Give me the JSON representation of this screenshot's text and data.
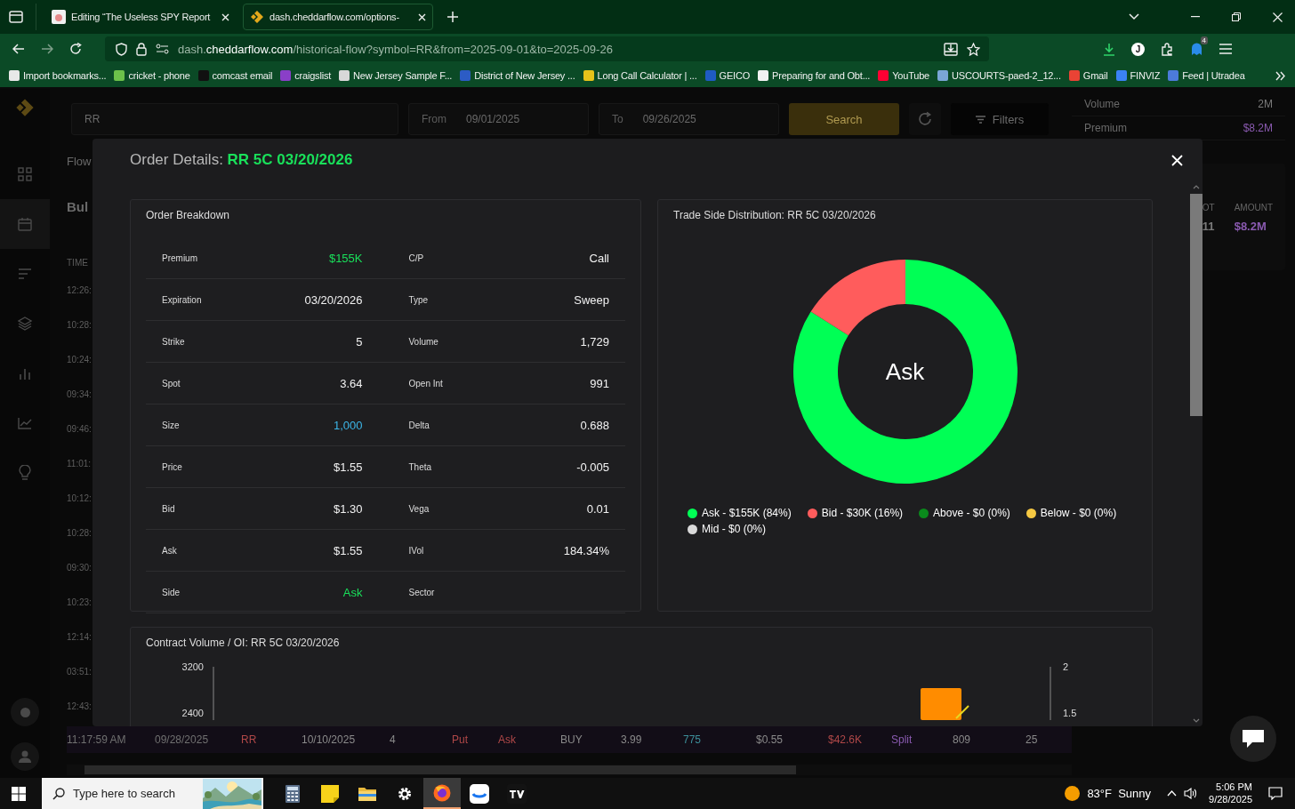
{
  "browser": {
    "tabs": [
      {
        "title": "Editing “The Useless SPY Report",
        "selected": false
      },
      {
        "title": "dash.cheddarflow.com/options-",
        "selected": true
      }
    ],
    "url": {
      "host_prefix": "dash.",
      "host": "cheddarflow.com",
      "path": "/historical-flow?symbol=RR&from=2025-09-01&to=2025-09-26"
    },
    "profile_initial": "J",
    "extension_badge": "4",
    "bookmarks": [
      {
        "label": "Import bookmarks...",
        "color": "#e8e8e8"
      },
      {
        "label": "cricket - phone",
        "color": "#6cc04a"
      },
      {
        "label": "comcast email",
        "color": "#111111"
      },
      {
        "label": "craigslist",
        "color": "#8a3fc8"
      },
      {
        "label": "New Jersey Sample F...",
        "color": "#d8d8d8"
      },
      {
        "label": "District of New Jersey ...",
        "color": "#2c5cc5"
      },
      {
        "label": "Long Call Calculator | ...",
        "color": "#e6c21a"
      },
      {
        "label": "GEICO",
        "color": "#1f5bc4"
      },
      {
        "label": "Preparing for and Obt...",
        "color": "#f2f2f2"
      },
      {
        "label": "YouTube",
        "color": "#ff0033"
      },
      {
        "label": "USCOURTS-paed-2_12...",
        "color": "#7aa6d6"
      },
      {
        "label": "Gmail",
        "color": "#ea4335"
      },
      {
        "label": "FINVIZ",
        "color": "#3b82f6"
      },
      {
        "label": "Feed | Utradea",
        "color": "#4c7bd9"
      }
    ]
  },
  "app": {
    "nav": [
      {
        "kind": "grid",
        "selected": false
      },
      {
        "kind": "calendar",
        "selected": true
      },
      {
        "kind": "list",
        "selected": false
      },
      {
        "kind": "layers",
        "selected": false
      },
      {
        "kind": "bars",
        "selected": false
      },
      {
        "kind": "trend",
        "selected": false
      },
      {
        "kind": "bulb",
        "selected": false
      }
    ],
    "search_value": "RR",
    "from_label": "From",
    "from_value": "09/01/2025",
    "to_label": "To",
    "to_value": "09/26/2025",
    "search_button": "Search",
    "filters_button": "Filters",
    "tab_partial": "Flow",
    "heading_partial": "Bul",
    "time_header": "TIME",
    "times": [
      "12:26:",
      "10:28:",
      "10:24:",
      "09:34:",
      "09:46:",
      "11:01:",
      "10:12:",
      "10:28:",
      "09:30:",
      "10:23:",
      "12:14:",
      "03:51:",
      "12:43:"
    ],
    "stats": [
      {
        "label": "Volume",
        "value": "2M",
        "color": "#7a7a7a"
      },
      {
        "label": "Premium",
        "value": "$8.2M",
        "color": "#8a5ab0"
      }
    ],
    "summary": [
      {
        "label": "OT",
        "value": "11",
        "color": "#7a7a7a"
      },
      {
        "label": "AMOUNT",
        "value": "$8.2M",
        "color": "#8a5ab0"
      }
    ],
    "last_row": [
      {
        "text": "11:17:59 AM",
        "color": "#707070"
      },
      {
        "text": "09/28/2025",
        "color": "#707070"
      },
      {
        "text": "RR",
        "color": "#b04848"
      },
      {
        "text": "10/10/2025",
        "color": "#8a8a8a"
      },
      {
        "text": "4",
        "color": "#8a8a8a"
      },
      {
        "text": "Put",
        "color": "#b04848"
      },
      {
        "text": "Ask",
        "color": "#b04848"
      },
      {
        "text": "BUY",
        "color": "#8a8a8a"
      },
      {
        "text": "3.99",
        "color": "#8a8a8a"
      },
      {
        "text": "775",
        "color": "#3d8f9a"
      },
      {
        "text": "$0.55",
        "color": "#8a8a8a"
      },
      {
        "text": "$42.6K",
        "color": "#b04848"
      },
      {
        "text": "Split",
        "color": "#8a5ab0"
      },
      {
        "text": "809",
        "color": "#8a8a8a"
      },
      {
        "text": "25",
        "color": "#8a8a8a"
      }
    ]
  },
  "modal": {
    "title": "Order Details:",
    "symbol": "RR 5C 03/20/2026",
    "breakdown_title": "Order Breakdown",
    "rows": [
      {
        "cells": [
          {
            "label": "Premium",
            "value": "$155K",
            "color": "#19e05a"
          },
          {
            "label": "C/P",
            "value": "Call",
            "color": "#f2f2f2"
          }
        ]
      },
      {
        "cells": [
          {
            "label": "Expiration",
            "value": "03/20/2026",
            "color": "#f2f2f2"
          },
          {
            "label": "Type",
            "value": "Sweep",
            "color": "#f2f2f2"
          }
        ]
      },
      {
        "cells": [
          {
            "label": "Strike",
            "value": "5",
            "color": "#f2f2f2"
          },
          {
            "label": "Volume",
            "value": "1,729",
            "color": "#f2f2f2"
          }
        ]
      },
      {
        "cells": [
          {
            "label": "Spot",
            "value": "3.64",
            "color": "#f2f2f2"
          },
          {
            "label": "Open Int",
            "value": "991",
            "color": "#f2f2f2"
          }
        ]
      },
      {
        "cells": [
          {
            "label": "Size",
            "value": "1,000",
            "color": "#3cb6e8"
          },
          {
            "label": "Delta",
            "value": "0.688",
            "color": "#f2f2f2"
          }
        ]
      },
      {
        "cells": [
          {
            "label": "Price",
            "value": "$1.55",
            "color": "#f2f2f2"
          },
          {
            "label": "Theta",
            "value": "-0.005",
            "color": "#f2f2f2"
          }
        ]
      },
      {
        "cells": [
          {
            "label": "Bid",
            "value": "$1.30",
            "color": "#f2f2f2"
          },
          {
            "label": "Vega",
            "value": "0.01",
            "color": "#f2f2f2"
          }
        ]
      },
      {
        "cells": [
          {
            "label": "Ask",
            "value": "$1.55",
            "color": "#f2f2f2"
          },
          {
            "label": "IVol",
            "value": "184.34%",
            "color": "#f2f2f2"
          }
        ]
      },
      {
        "cells": [
          {
            "label": "Side",
            "value": "Ask",
            "color": "#19e05a"
          },
          {
            "label": "Sector"
          }
        ]
      }
    ],
    "distribution": {
      "center_label": "Ask",
      "chart_data": {
        "type": "donut",
        "title": "Trade Side Distribution: RR 5C 03/20/2026",
        "categories": [
          "Ask - $155K (84%)",
          "Bid - $30K (16%)",
          "Above - $0 (0%)",
          "Below - $0 (0%)",
          "Mid - $0 (0%)"
        ],
        "series": [
          {
            "values": [
              84,
              16,
              0,
              0,
              0
            ]
          }
        ]
      },
      "legend": [
        {
          "color": "#00ff55"
        },
        {
          "color": "#ff5c5c"
        },
        {
          "color": "#0a8a1c"
        },
        {
          "color": "#f5c842"
        },
        {
          "color": "#d9d9d9"
        }
      ]
    },
    "volume": {
      "title": "Contract Volume / OI: RR 5C 03/20/2026",
      "left_ticks": [
        "3200",
        "2400"
      ],
      "right_ticks": [
        "2",
        "1.5"
      ]
    }
  },
  "taskbar": {
    "search_placeholder": "Type here to search",
    "weather": "83°F  Sunny",
    "time": "5:06 PM",
    "date": "9/28/2025",
    "apps": [
      {
        "kind": "calculator",
        "selected": false
      },
      {
        "kind": "notes",
        "selected": false
      },
      {
        "kind": "folder",
        "selected": false
      },
      {
        "kind": "gear",
        "selected": false
      },
      {
        "kind": "browser",
        "selected": true
      },
      {
        "kind": "cloud",
        "selected": false
      },
      {
        "kind": "chart",
        "selected": false
      }
    ]
  }
}
